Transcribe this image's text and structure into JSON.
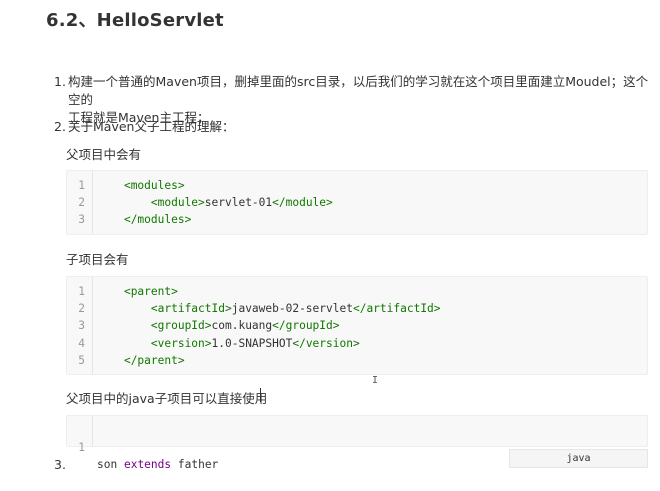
{
  "heading": "6.2、HelloServlet",
  "list": [
    {
      "num": "1.",
      "line1": "构建一个普通的Maven项目，删掉里面的src目录，以后我们的学习就在这个项目里面建立Moudel；这个空的",
      "line2": "工程就是Maven主工程；"
    },
    {
      "num": "2.",
      "line1": "关于Maven父子工程的理解："
    },
    {
      "num": "3."
    }
  ],
  "para_parent": "父项目中会有",
  "code_modules": {
    "lines": [
      {
        "n": "1",
        "indent": "    ",
        "open": "<modules>",
        "text": "",
        "close": ""
      },
      {
        "n": "2",
        "indent": "        ",
        "open": "<module>",
        "text": "servlet-01",
        "close": "</module>"
      },
      {
        "n": "3",
        "indent": "    ",
        "open": "</modules>",
        "text": "",
        "close": ""
      }
    ]
  },
  "para_child": "子项目会有",
  "code_parent": {
    "lines": [
      {
        "n": "1",
        "indent": "    ",
        "open": "<parent>",
        "text": "",
        "close": ""
      },
      {
        "n": "2",
        "indent": "        ",
        "open": "<artifactId>",
        "text": "javaweb-02-servlet",
        "close": "</artifactId>"
      },
      {
        "n": "3",
        "indent": "        ",
        "open": "<groupId>",
        "text": "com.kuang",
        "close": "</groupId>"
      },
      {
        "n": "4",
        "indent": "        ",
        "open": "<version>",
        "text": "1.0-SNAPSHOT",
        "close": "</version>"
      },
      {
        "n": "5",
        "indent": "    ",
        "open": "</parent>",
        "text": "",
        "close": ""
      }
    ]
  },
  "para_java": "父项目中的java子项目可以直接使用",
  "code_java": {
    "line_number": "1",
    "word1": "son",
    "keyword": "extends",
    "word2": "father"
  },
  "lang_label": "java",
  "colors": {
    "tag": "#117700",
    "keyword": "#770088",
    "line_number": "#999999"
  }
}
